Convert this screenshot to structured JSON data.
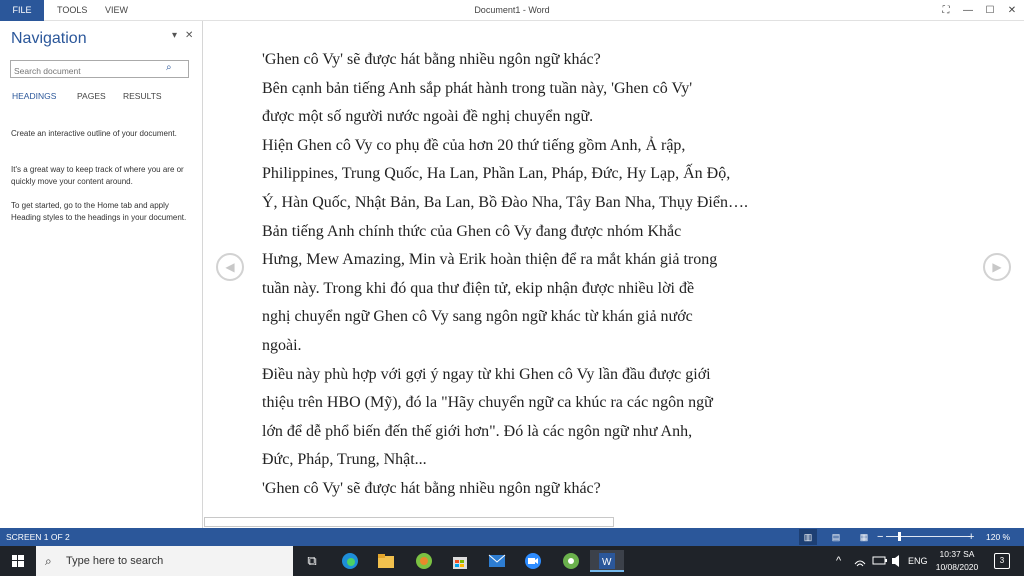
{
  "titlebar": {
    "file_tab": "FILE",
    "menu": [
      "TOOLS",
      "VIEW"
    ],
    "doc_title": "Document1 - Word",
    "controls": {
      "fullscreen": "⛶",
      "minimize": "—",
      "maximize": "☐",
      "close": "✕"
    }
  },
  "nav": {
    "title": "Navigation",
    "dropdown_glyph": "▾",
    "close_glyph": "✕",
    "search_placeholder": "Search document",
    "search_glyph": "⌕",
    "tabs": [
      "HEADINGS",
      "PAGES",
      "RESULTS"
    ],
    "help": [
      "Create an interactive outline of your document.",
      "It's a great way to keep track of where you are or quickly move your content around.",
      "To get started, go to the Home tab and apply Heading styles to the headings in your document."
    ]
  },
  "document": {
    "lines": [
      "'Ghen cô Vy' sẽ được hát bằng nhiều ngôn ngữ khác?",
      "Bên cạnh bản tiếng Anh sắp phát hành trong tuần này, 'Ghen cô Vy'",
      "được một số người nước ngoài đề nghị chuyển ngữ.",
      "Hiện Ghen cô Vy co phụ đề của hơn 20 thứ tiếng gồm Anh, Ả rập,",
      "Philippines, Trung Quốc, Ha Lan, Phần Lan, Pháp, Đức, Hy Lạp, Ấn Độ,",
      "Ý, Hàn Quốc, Nhật Bản, Ba Lan, Bồ Đào Nha, Tây Ban Nha, Thụy Điển….",
      "Bản tiếng Anh chính thức của Ghen cô Vy đang được nhóm Khắc",
      "Hưng, Mew Amazing, Min và Erik hoàn thiện để ra mắt khán giả trong",
      "tuần này. Trong khi đó qua thư điện tử, ekip nhận được nhiều lời đề",
      "nghị chuyển ngữ Ghen cô Vy sang ngôn ngữ khác từ khán giả nước",
      "ngoài.",
      "Điều này phù hợp với gợi ý ngay từ khi Ghen cô Vy lần đầu được giới",
      "thiệu trên HBO (Mỹ), đó la \"Hãy chuyển ngữ ca khúc ra các ngôn ngữ",
      "lớn để dễ phổ biến đến thế giới hơn\". Đó là các ngôn ngữ như Anh,",
      "Đức, Pháp, Trung, Nhật...",
      "'Ghen cô Vy' sẽ được hát bằng nhiều ngôn ngữ khác?"
    ],
    "prev_glyph": "◀",
    "next_glyph": "▶"
  },
  "status": {
    "screen": "SCREEN 1 OF 2",
    "view_glyphs": [
      "▥",
      "▤",
      "▦"
    ],
    "zoom_minus": "−",
    "zoom_plus": "+",
    "zoom": "120 %",
    "zoom_fraction": 0.15
  },
  "taskbar": {
    "search_placeholder": "Type here to search",
    "search_glyph": "⌕",
    "task_view_glyph": "⧉",
    "apps": [
      "edge",
      "file-explorer",
      "green-app",
      "store",
      "mail",
      "video",
      "photos",
      "word"
    ],
    "tray_up": "^",
    "tray_lang": "ENG",
    "time": "10:37 SA",
    "date": "10/08/2020",
    "notifications": "3"
  },
  "colors": {
    "accent": "#2b579a",
    "taskbar": "#1f2329"
  }
}
